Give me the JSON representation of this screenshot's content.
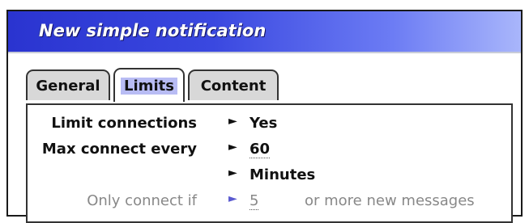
{
  "window": {
    "title": "New simple notification"
  },
  "tabs": [
    {
      "label": "General"
    },
    {
      "label": "Limits"
    },
    {
      "label": "Content"
    }
  ],
  "rows": {
    "limit_connections": {
      "label": "Limit connections",
      "value": "Yes"
    },
    "max_connect_every": {
      "label": "Max connect every",
      "value": "60"
    },
    "unit": {
      "value": "Minutes"
    },
    "only_connect_if": {
      "label": "Only connect if",
      "value": "5",
      "suffix": "or more new messages"
    }
  },
  "icons": {
    "selector": "right-arrow-icon"
  },
  "colors": {
    "title_start": "#2a34d0",
    "title_end": "#a9b6fb",
    "selected_tab_highlight": "#b8bcf4",
    "disabled_text": "#888888"
  }
}
